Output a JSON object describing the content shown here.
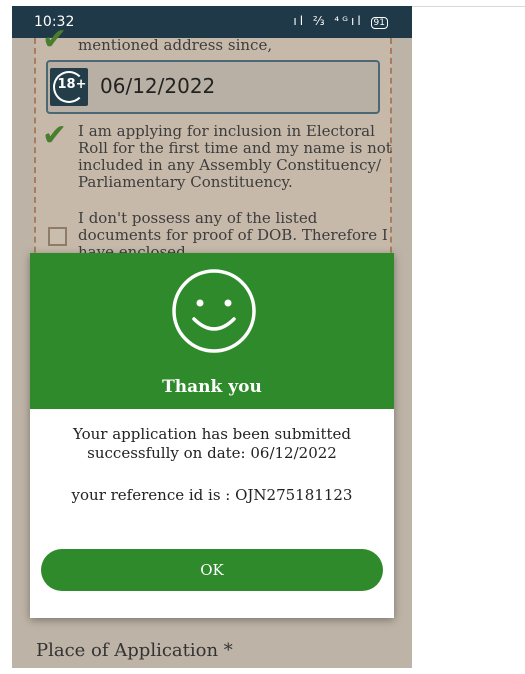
{
  "statusbar": {
    "time": "10:32",
    "icons_text": "▐ ░ ∷▐ ▭",
    "icon_names": [
      "vibrate-icon",
      "volte-icon",
      "signal-icon",
      "battery-icon"
    ],
    "battery_level": "91"
  },
  "form": {
    "residence_text": "mentioned address since,",
    "age_badge": "18+",
    "date_value": "06/12/2022",
    "first_time_line1": "I am applying for inclusion in Electoral",
    "first_time_line2": "Roll for the first time and my name is not",
    "first_time_line3": "included in any Assembly Constituency/",
    "first_time_line4": "Parliamentary Constituency.",
    "dob_line1": "I don't possess any of the listed",
    "dob_line2": "documents for proof of DOB. Therefore I",
    "dob_line3": "have enclosed",
    "place_label": "Place of Application *"
  },
  "modal": {
    "title": "Thank you",
    "message_line1": "Your application has been submitted",
    "message_line2": "successfully on date: 06/12/2022",
    "reference_text": "your reference id is : OJN275181123",
    "ok_label": "OK"
  },
  "colors": {
    "header_green": "#2f8a2b",
    "statusbar": "#1f3948",
    "check_green": "#4b7d2f"
  }
}
